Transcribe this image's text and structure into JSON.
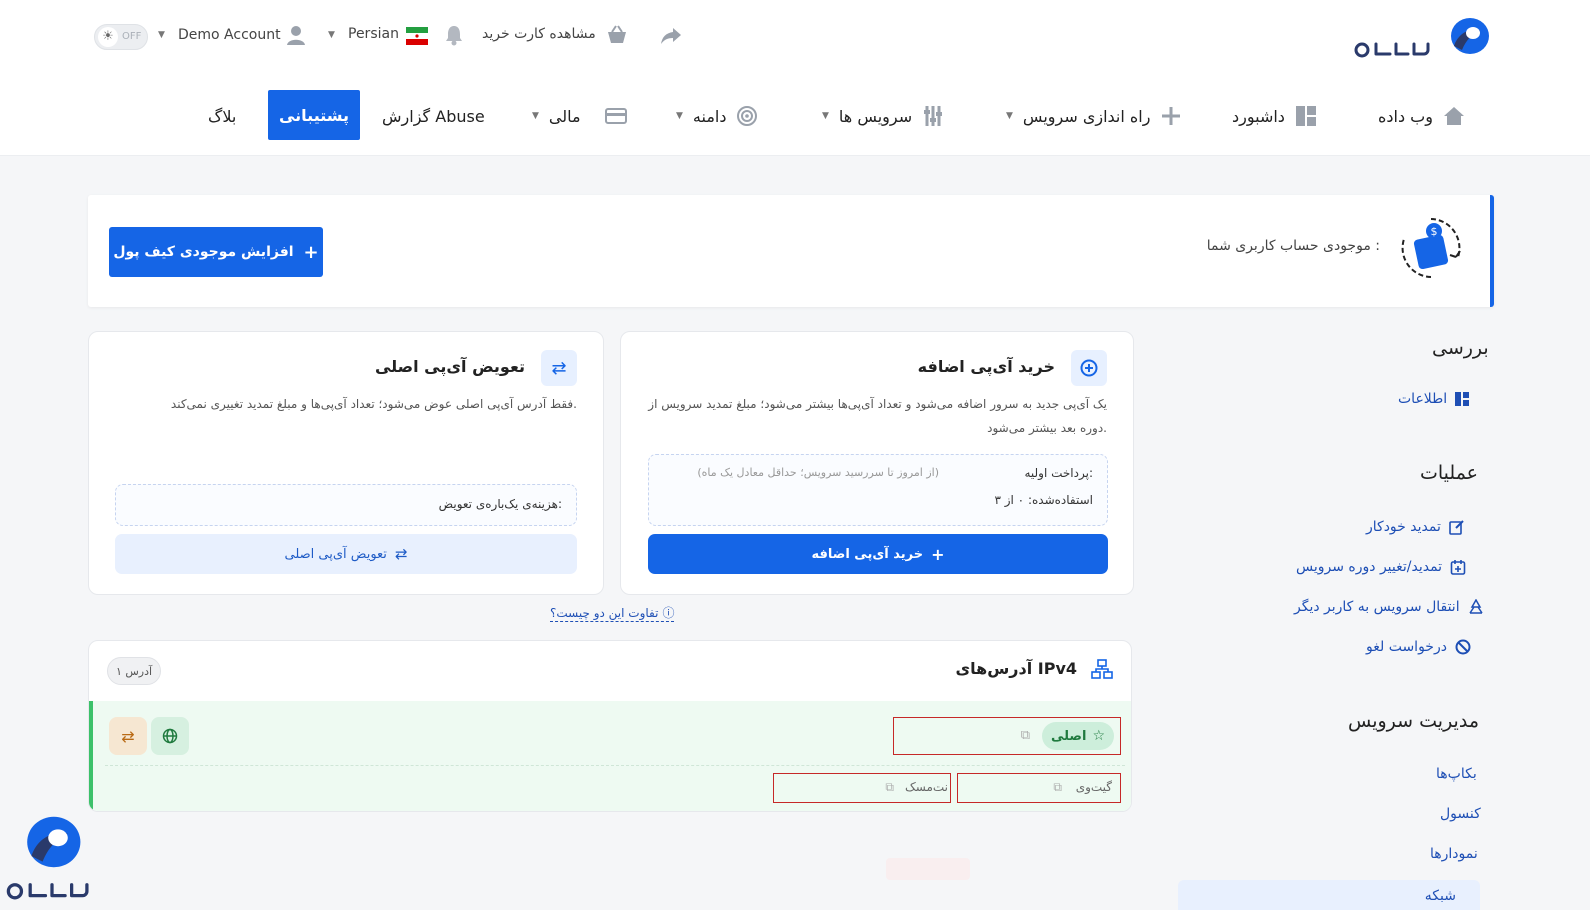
{
  "brand": {
    "name": "وب داده",
    "accent": "#1565e6",
    "green": "#3cc16a"
  },
  "topbar": {
    "theme_toggle": "OFF",
    "account": "Demo Account",
    "language": "Persian",
    "cart_link": "مشاهده کارت خرید",
    "icons": [
      "share-icon",
      "basket-icon",
      "bell-icon",
      "iran-flag-icon",
      "user-icon",
      "sun-icon"
    ]
  },
  "nav": {
    "home": "وب داده",
    "dashboard": "داشبورد",
    "setup": "راه اندازی سرویس",
    "services": "سرویس ها",
    "domain": "دامنه",
    "finance": "مالی",
    "abuse": "گزارش Abuse",
    "support": "پشتیبانی",
    "blog": "بلاگ"
  },
  "wallet": {
    "label": "موجودی حساب کاربری شما :",
    "button": "افزایش موجودی کیف پول"
  },
  "sidebar": {
    "review_title": "بررسی",
    "info": "اطلاعات",
    "operations_title": "عملیات",
    "operations": [
      "تمدید خودکار",
      "تمدید/تغییر دوره سرویس",
      "انتقال سرویس به کاربر دیگر",
      "درخواست لغو"
    ],
    "management_title": "مدیریت سرویس",
    "management": [
      "بکاپ‌ها",
      "کنسول",
      "نمودارها",
      "شبکه"
    ]
  },
  "buy_ip": {
    "title": "خرید آی‌پی اضافه",
    "description_line1": "یک آی‌پی جدید به سرور اضافه می‌شود و تعداد آی‌پی‌ها بیشتر می‌شود؛ مبلغ تمدید سرویس از",
    "description_line2": "دوره بعد بیشتر می‌شود.",
    "initial_payment_label": "پرداخت اولیه:",
    "initial_payment_note": "(از امروز تا سررسید سرویس؛ حداقل معادل یک ماه)",
    "used_label": "استفاده‌شده: ۰ از ۳",
    "button": "خرید آی‌پی اضافه"
  },
  "swap_ip": {
    "title": "تعویض آی‌پی اصلی",
    "description": "فقط آدرس آی‌پی اصلی عوض می‌شود؛ تعداد آی‌پی‌ها و مبلغ تمدید تغییری نمی‌کند.",
    "cost_label": "هزینه‌ی یک‌باره‌ی تعویض:",
    "button": "تعویض آی‌پی اصلی"
  },
  "difference_link": "تفاوت این دو چیست؟",
  "ipv4": {
    "title": "آدرس‌های IPv4",
    "count_badge": "۱ آدرس",
    "primary_badge": "اصلی",
    "gateway_label": "گیت‌وی",
    "netmask_label": "نت‌مسک"
  }
}
